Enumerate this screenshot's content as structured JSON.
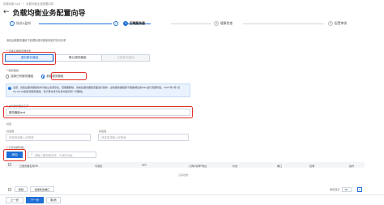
{
  "breadcrumb": [
    "负载均衡 SLB",
    "负载均衡业务配置向导"
  ],
  "page_title": "负载均衡业务配置向导",
  "steps": [
    {
      "num": "1",
      "label": "协议&监听",
      "state": "done"
    },
    {
      "num": "2",
      "label": "后端服务器",
      "state": "done"
    },
    {
      "num": "3",
      "label": "后端服务器",
      "state": "active"
    },
    {
      "num": "4",
      "label": "健康检查",
      "state": "todo"
    },
    {
      "num": "5",
      "label": "配置审核",
      "state": "todo"
    }
  ],
  "hint": "添加后端服务器用于处理负载均衡接收到的访问请求",
  "server_type_label": "选择后端服务器类型",
  "server_group_tabs": [
    "虚拟服务器组",
    "默认服务器组",
    "主备服务器组"
  ],
  "group_type_label": "服务器组",
  "radio_options": [
    "选择已有服务器组",
    "新建服务器组"
  ],
  "notice_text": "注意：创建后服务器组将作为独立资源存在，若需要删除，请前往服务器组页面进行操作，虚拟服务器组用于根据域名或URL进行流量转发，2021年3月1日 00:00:00起新增服务器组，将不再支持与负载均衡实例一同删除。",
  "group_name_label": "虚拟服务器组名称",
  "group_name_value": "服务器组test",
  "tags": {
    "section_label": "标签",
    "key_label": "标签键",
    "key_placeholder": "请选择或输入标签键",
    "value_label": "标签值",
    "value_placeholder": "请选择或输入标签值"
  },
  "added_label": "已添加服务器",
  "add_button": "添加",
  "search_placeholder": "请输入服务器名称、ID或IP地址",
  "columns": [
    "云服务器名称/ID",
    "可用区",
    "VPC",
    "公网/内网IP地址",
    "状态",
    "端口",
    "权重",
    "操作"
  ],
  "empty_text": "没有数据",
  "footer": {
    "remove": "移除",
    "batch_modify": "批量修改端口",
    "per_page_label": "每页显示",
    "per_page": "20",
    "page": "1"
  },
  "nav": {
    "prev": "上一步",
    "next": "下一步",
    "cancel": "取消"
  },
  "colors": {
    "accent": "#1f6fd6",
    "highlight": "#e0302a"
  }
}
